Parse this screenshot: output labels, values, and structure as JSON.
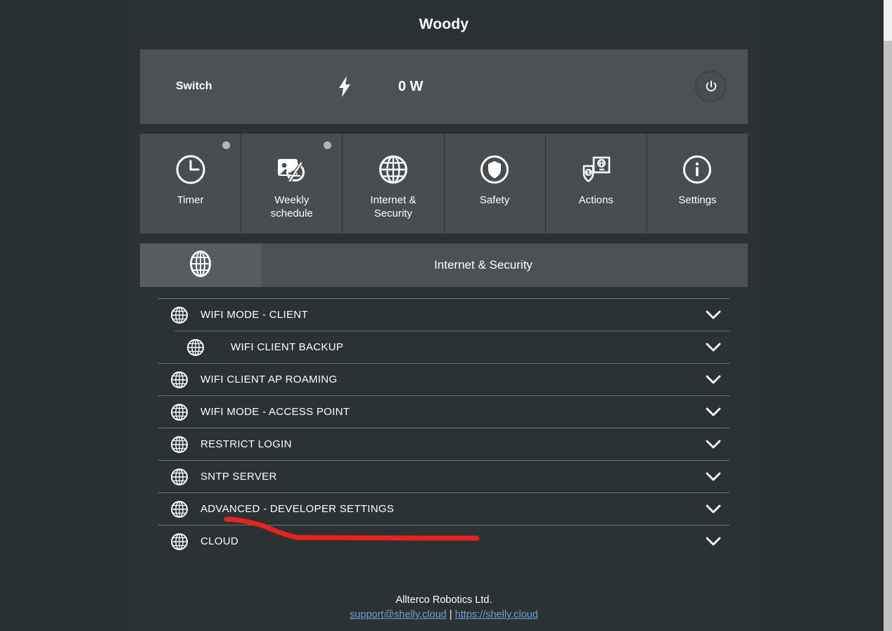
{
  "device": {
    "title": "Woody"
  },
  "switch_bar": {
    "label": "Switch",
    "bolt_icon": "lightning-bolt-icon",
    "power_reading": "0 W",
    "power_button_icon": "power-icon"
  },
  "tiles": [
    {
      "label": "Timer",
      "icon": "clock-icon",
      "has_dot": true
    },
    {
      "label": "Weekly\nschedule",
      "label_line1": "Weekly",
      "label_line2": "schedule",
      "icon": "calendar-slash-icon",
      "has_dot": true
    },
    {
      "label": "Internet &\nSecurity",
      "label_line1": "Internet &",
      "label_line2": "Security",
      "icon": "globe-icon",
      "has_dot": false
    },
    {
      "label": "Safety",
      "icon": "shield-icon",
      "has_dot": false
    },
    {
      "label": "Actions",
      "icon": "actions-icon",
      "has_dot": false
    },
    {
      "label": "Settings",
      "icon": "info-icon",
      "has_dot": false
    }
  ],
  "section": {
    "icon": "globe-icon",
    "title": "Internet & Security"
  },
  "accordion": [
    {
      "label": "WIFI MODE - CLIENT",
      "icon": "globe-icon",
      "indent": false,
      "chevron": "chevron-down-icon"
    },
    {
      "label": "WIFI CLIENT BACKUP",
      "icon": "globe-icon",
      "indent": true,
      "chevron": "chevron-down-icon"
    },
    {
      "label": "WIFI CLIENT AP ROAMING",
      "icon": "globe-icon",
      "indent": false,
      "chevron": "chevron-down-icon"
    },
    {
      "label": "WIFI MODE - ACCESS POINT",
      "icon": "globe-icon",
      "indent": false,
      "chevron": "chevron-down-icon"
    },
    {
      "label": "RESTRICT LOGIN",
      "icon": "globe-icon",
      "indent": false,
      "chevron": "chevron-down-icon"
    },
    {
      "label": "SNTP SERVER",
      "icon": "globe-icon",
      "indent": false,
      "chevron": "chevron-down-icon"
    },
    {
      "label": "ADVANCED - DEVELOPER SETTINGS",
      "icon": "globe-icon",
      "indent": false,
      "chevron": "chevron-down-icon"
    },
    {
      "label": "CLOUD",
      "icon": "globe-icon",
      "indent": false,
      "chevron": "chevron-down-icon"
    }
  ],
  "footer": {
    "company": "Allterco Robotics Ltd.",
    "email": "support@shelly.cloud",
    "separator": "|",
    "website": "https://shelly.cloud"
  },
  "annotation": {
    "type": "freehand-line",
    "color": "#e8221f"
  },
  "colors": {
    "page_background": "#272f31",
    "app_background": "#2a3234",
    "panel": "#4b5154",
    "tile": "#474d50",
    "tile_active": "#565c5f",
    "text": "#ffffff",
    "link": "#6f9fd8",
    "divider": "#6d7477",
    "status_dot": "#b5b5b5",
    "annotation": "#e8221f"
  }
}
